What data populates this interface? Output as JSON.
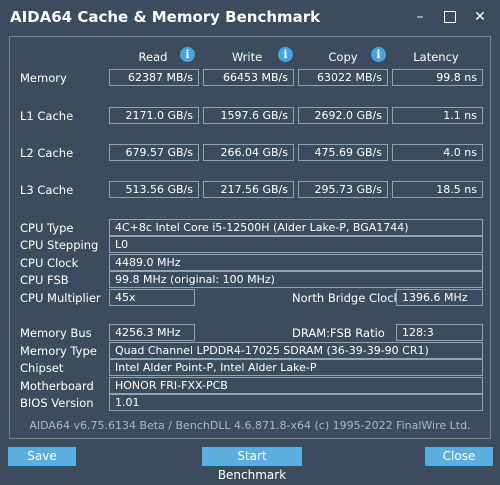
{
  "window": {
    "title": "AIDA64 Cache & Memory Benchmark"
  },
  "columns": {
    "read": "Read",
    "write": "Write",
    "copy": "Copy",
    "latency": "Latency"
  },
  "rows": [
    {
      "label": "Memory",
      "read": "62387 MB/s",
      "write": "66453 MB/s",
      "copy": "63022 MB/s",
      "latency": "99.8 ns"
    },
    {
      "label": "L1 Cache",
      "read": "2171.0 GB/s",
      "write": "1597.6 GB/s",
      "copy": "2692.0 GB/s",
      "latency": "1.1 ns"
    },
    {
      "label": "L2 Cache",
      "read": "679.57 GB/s",
      "write": "266.04 GB/s",
      "copy": "475.69 GB/s",
      "latency": "4.0 ns"
    },
    {
      "label": "L3 Cache",
      "read": "513.56 GB/s",
      "write": "217.56 GB/s",
      "copy": "295.73 GB/s",
      "latency": "18.5 ns"
    }
  ],
  "cpu": {
    "type_label": "CPU Type",
    "type": "4C+8c Intel Core i5-12500H  (Alder Lake-P, BGA1744)",
    "stepping_label": "CPU Stepping",
    "stepping": "L0",
    "clock_label": "CPU Clock",
    "clock": "4489.0 MHz",
    "fsb_label": "CPU FSB",
    "fsb": "99.8 MHz  (original: 100 MHz)",
    "multiplier_label": "CPU Multiplier",
    "multiplier": "45x",
    "nb_clock_label": "North Bridge Clock",
    "nb_clock": "1396.6 MHz"
  },
  "memory": {
    "bus_label": "Memory Bus",
    "bus": "4256.3 MHz",
    "ratio_label": "DRAM:FSB Ratio",
    "ratio": "128:3",
    "type_label": "Memory Type",
    "type": "Quad Channel LPDDR4-17025 SDRAM  (36-39-39-90 CR1)",
    "chipset_label": "Chipset",
    "chipset": "Intel Alder Point-P, Intel Alder Lake-P",
    "motherboard_label": "Motherboard",
    "motherboard": "HONOR FRI-FXX-PCB",
    "bios_label": "BIOS Version",
    "bios": "1.01"
  },
  "footer": "AIDA64 v6.75.6134 Beta / BenchDLL 4.6.871.8-x64  (c) 1995-2022 FinalWire Ltd.",
  "buttons": {
    "save": "Save",
    "start": "Start Benchmark",
    "close": "Close"
  },
  "icons": {
    "info": "i",
    "minimize": "–",
    "close": "✕"
  },
  "colors": {
    "background": "#3b4d5c",
    "accent": "#5aafe0",
    "info_icon": "#4aa3df",
    "border": "#8fa3b3"
  }
}
